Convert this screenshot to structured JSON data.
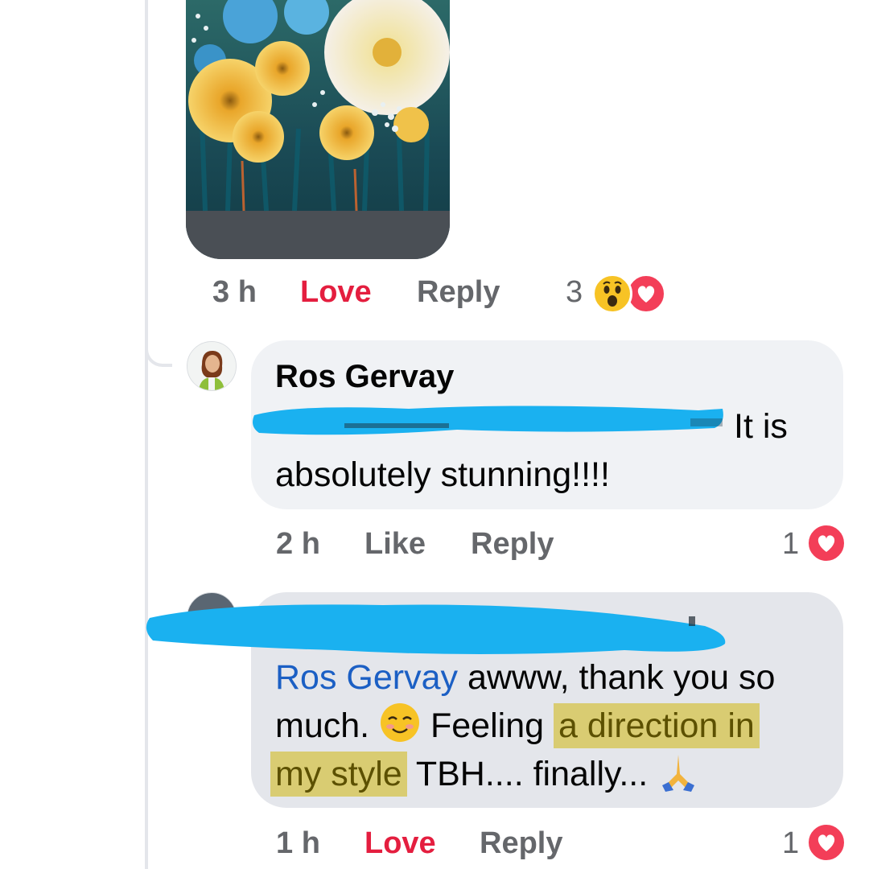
{
  "comment_top": {
    "time": "3 h",
    "reaction_action": "Love",
    "reply_label": "Reply",
    "reaction_count": "3",
    "reaction_icons": [
      "wow-emoji",
      "love-heart"
    ]
  },
  "comment_ros": {
    "author": "Ros Gervay",
    "text_line1_visible": "It is",
    "text_line2": "absolutely stunning!!!!",
    "time": "2 h",
    "like_label": "Like",
    "reply_label": "Reply",
    "reaction_count": "1",
    "reaction_icons": [
      "love-heart"
    ]
  },
  "comment_reply": {
    "mention": "Ros Gervay",
    "line1_rest": " awww, thank you so",
    "line2_a": "much. ",
    "line2_b": " Feeling ",
    "line2_highlight": "a direction in",
    "line3_highlight": "my style",
    "line3_rest": " TBH.... finally... ",
    "emojis": [
      "smiling-face-emoji",
      "folded-hands-emoji"
    ],
    "time": "1 h",
    "reaction_action": "Love",
    "reply_label": "Reply",
    "reaction_count": "1",
    "reaction_icons": [
      "love-heart"
    ]
  },
  "colors": {
    "love": "#e41e3f",
    "meta": "#65676b",
    "mention": "#1b5fc4",
    "highlight": "#d9cc72",
    "redaction": "#1ab1f0"
  }
}
